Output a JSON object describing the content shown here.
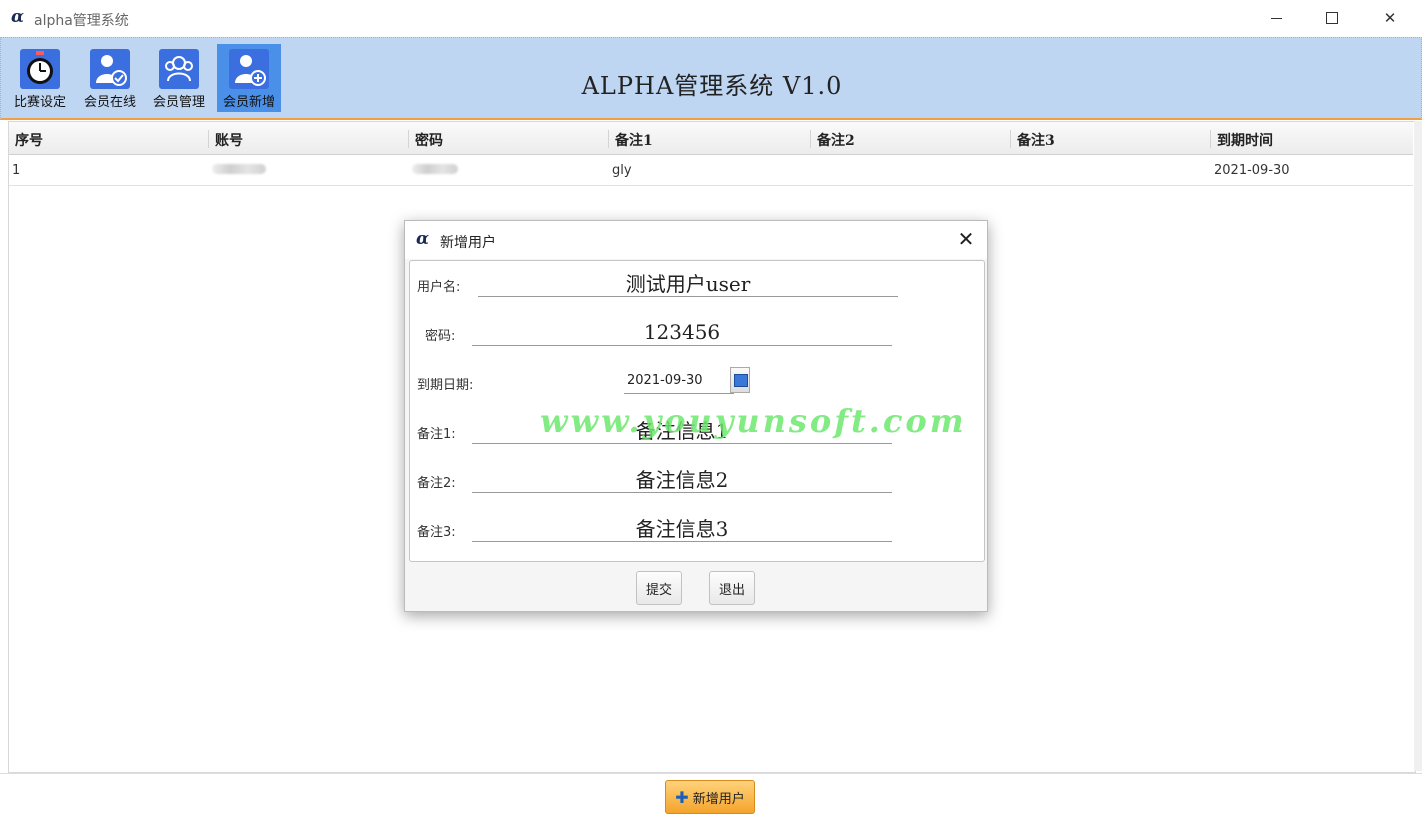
{
  "window": {
    "title": "alpha管理系统",
    "logo_glyph": "α"
  },
  "toolbar": {
    "heading": "ALPHA管理系统 V1.0",
    "buttons": [
      {
        "label": "比赛设定",
        "icon": "stopwatch-icon"
      },
      {
        "label": "会员在线",
        "icon": "user-check-icon"
      },
      {
        "label": "会员管理",
        "icon": "users-icon"
      },
      {
        "label": "会员新增",
        "icon": "user-add-icon",
        "active": true
      }
    ]
  },
  "table": {
    "columns": [
      "序号",
      "账号",
      "密码",
      "备注1",
      "备注2",
      "备注3",
      "到期时间"
    ],
    "rows": [
      {
        "index": "1",
        "remark1": "gly",
        "remark2": "",
        "remark3": "",
        "expiry": "2021-09-30"
      }
    ]
  },
  "dialog": {
    "title": "新增用户",
    "fields": {
      "username_label": "用户名:",
      "username_value": "测试用户user",
      "password_label": "密码:",
      "password_value": "123456",
      "expiry_label": "到期日期:",
      "expiry_value": "2021-09-30",
      "remark1_label": "备注1:",
      "remark1_value": "备注信息1",
      "remark2_label": "备注2:",
      "remark2_value": "备注信息2",
      "remark3_label": "备注3:",
      "remark3_value": "备注信息3"
    },
    "submit_label": "提交",
    "exit_label": "退出",
    "watermark": "www.youyunsoft.com"
  },
  "bottom": {
    "add_user_label": "新增用户"
  },
  "colors": {
    "toolbar_bg": "#bfd6f2",
    "accent_orange": "#f4a42c",
    "active_tab": "#4a90e8",
    "watermark": "#6ee86e"
  }
}
